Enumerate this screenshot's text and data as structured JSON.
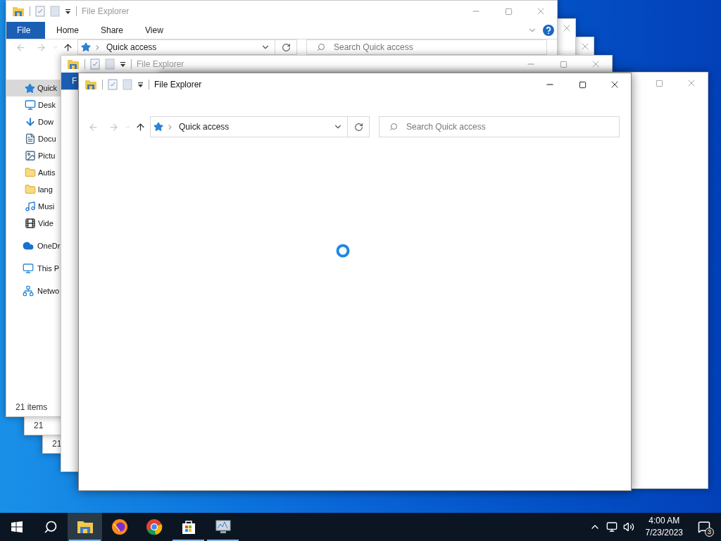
{
  "windows": [
    {
      "active": false,
      "status": "21"
    },
    {
      "active": false,
      "status": "21"
    },
    {
      "active": false,
      "title": "File Explorer",
      "ribbon": [
        {
          "label": "File",
          "kind": "file"
        },
        {
          "label": "Home",
          "kind": "tab"
        },
        {
          "label": "Share",
          "kind": "tab"
        },
        {
          "label": "View",
          "kind": "tab"
        }
      ],
      "address": "Quick access",
      "search_placeholder": "Search Quick access",
      "sidebar": [
        {
          "label": "Quick",
          "selected": true,
          "kind": "item"
        },
        {
          "label": "Desk",
          "selected": false,
          "kind": "item"
        },
        {
          "label": "Dow",
          "selected": false,
          "kind": "item"
        },
        {
          "label": "Docu",
          "selected": false,
          "kind": "item"
        },
        {
          "label": "Pictu",
          "selected": false,
          "kind": "item"
        },
        {
          "label": "Autis",
          "selected": false,
          "kind": "item"
        },
        {
          "label": "lang",
          "selected": false,
          "kind": "item"
        },
        {
          "label": "Musi",
          "selected": false,
          "kind": "item"
        },
        {
          "label": "Vide",
          "selected": false,
          "kind": "item"
        },
        {
          "label": "OneDr",
          "selected": false,
          "kind": "root"
        },
        {
          "label": "This P",
          "selected": false,
          "kind": "root"
        },
        {
          "label": "Netwo",
          "selected": false,
          "kind": "root"
        }
      ],
      "status": "21 items"
    },
    {
      "active": false,
      "title": "File Explorer",
      "ribbon": [
        {
          "label": "F",
          "kind": "file"
        }
      ]
    },
    {
      "active": false
    },
    {
      "active": true,
      "title": "File Explorer",
      "address": "Quick access",
      "search_placeholder": "Search Quick access",
      "loading": true
    }
  ],
  "taskbar": {
    "apps": [
      {
        "selected": true,
        "running": true
      },
      {
        "selected": false,
        "running": false
      },
      {
        "selected": false,
        "running": false
      },
      {
        "selected": false,
        "running": true
      },
      {
        "selected": false,
        "running": true
      }
    ],
    "time": "4:00 AM",
    "date": "7/23/2023",
    "notifications": "3"
  }
}
